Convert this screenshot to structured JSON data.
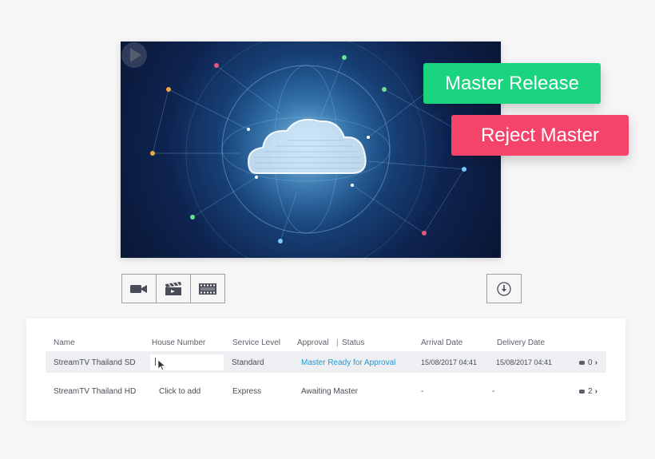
{
  "video": {
    "play_icon": "play-icon"
  },
  "actions": {
    "master_release": "Master Release",
    "reject_master": "Reject Master",
    "release_color": "#1ad47f",
    "reject_color": "#f5446a"
  },
  "toolbar": {
    "icons": [
      "video-camera-icon",
      "clapperboard-icon",
      "film-strip-icon"
    ],
    "download_icon": "download-icon"
  },
  "table": {
    "headers": {
      "name": "Name",
      "house_number": "House Number",
      "service_level": "Service Level",
      "approval": "Approval",
      "status": "Status",
      "arrival_date": "Arrival Date",
      "delivery_date": "Delivery Date"
    },
    "rows": [
      {
        "name": "StreamTV Thailand SD",
        "house_number": "",
        "service_level": "Standard",
        "status": "Master Ready for Approval",
        "arrival_date": "15/08/2017 04:41",
        "delivery_date": "15/08/2017 04:41",
        "comments": "0"
      },
      {
        "name": "StreamTV Thailand HD",
        "house_number": "Click to add",
        "service_level": "Express",
        "status": "Awaiting Master",
        "arrival_date": "-",
        "delivery_date": "-",
        "comments": "2"
      }
    ]
  }
}
